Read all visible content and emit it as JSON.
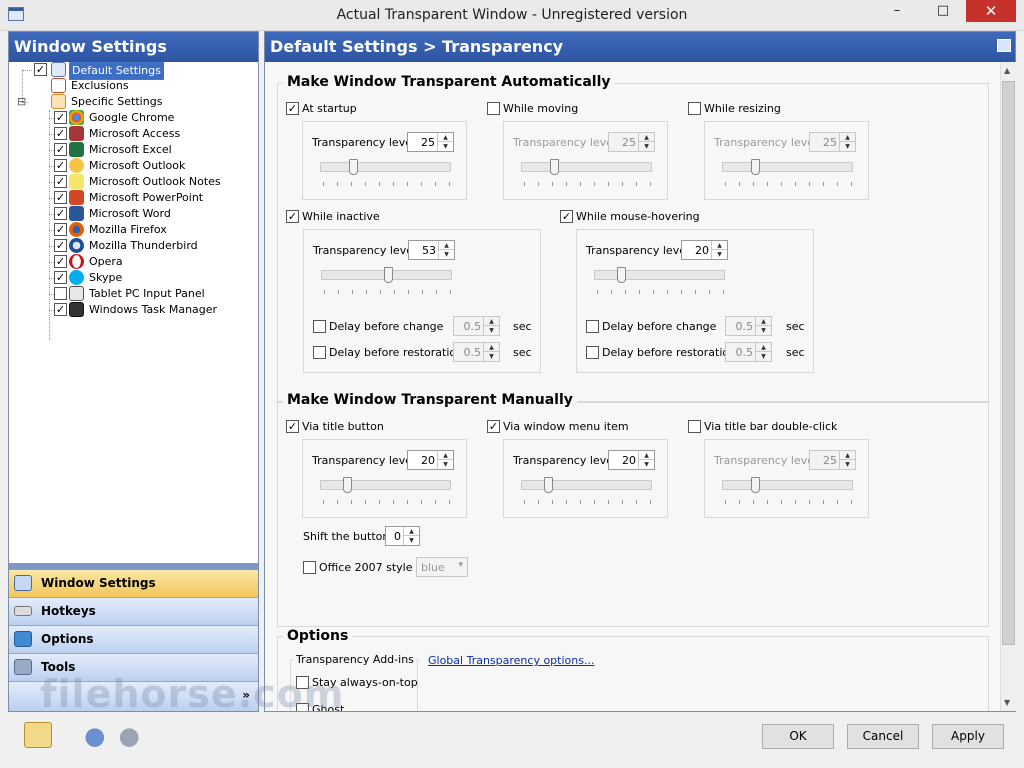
{
  "window": {
    "title": "Actual Transparent Window - Unregistered version",
    "minimize_glyph": "–",
    "maximize_glyph": "□",
    "close_glyph": "✕"
  },
  "left": {
    "header": "Window Settings",
    "tree": [
      {
        "label": "Default Settings",
        "checked": true,
        "selected": true
      },
      {
        "label": "Exclusions"
      },
      {
        "label": "Specific Settings",
        "expander": "⊟"
      },
      {
        "label": "Google Chrome",
        "checked": true
      },
      {
        "label": "Microsoft Access",
        "checked": true
      },
      {
        "label": "Microsoft Excel",
        "checked": true
      },
      {
        "label": "Microsoft Outlook",
        "checked": true
      },
      {
        "label": "Microsoft Outlook Notes",
        "checked": true
      },
      {
        "label": "Microsoft PowerPoint",
        "checked": true
      },
      {
        "label": "Microsoft Word",
        "checked": true
      },
      {
        "label": "Mozilla Firefox",
        "checked": true
      },
      {
        "label": "Mozilla Thunderbird",
        "checked": true
      },
      {
        "label": "Opera",
        "checked": true
      },
      {
        "label": "Skype",
        "checked": true
      },
      {
        "label": "Tablet PC Input Panel",
        "checked": false
      },
      {
        "label": "Windows Task Manager",
        "checked": true
      }
    ],
    "nav": {
      "window_settings": "Window Settings",
      "hotkeys": "Hotkeys",
      "options": "Options",
      "tools": "Tools",
      "more_glyph": "»"
    }
  },
  "right": {
    "header": "Default Settings > Transparency",
    "auto": {
      "title": "Make Window Transparent Automatically",
      "at_startup": {
        "label": "At startup",
        "checked": true,
        "level_label": "Transparency level",
        "level": "25"
      },
      "while_moving": {
        "label": "While moving",
        "checked": false,
        "level_label": "Transparency level",
        "level": "25"
      },
      "while_resizing": {
        "label": "While resizing",
        "checked": false,
        "level_label": "Transparency level",
        "level": "25"
      },
      "while_inactive": {
        "label": "While inactive",
        "checked": true,
        "level_label": "Transparency level",
        "level": "53",
        "delay_change": "Delay before change",
        "delay_change_value": "0.5",
        "delay_restore": "Delay before restoration",
        "delay_restore_value": "0.5",
        "unit": "sec"
      },
      "while_hovering": {
        "label": "While mouse-hovering",
        "checked": true,
        "level_label": "Transparency level",
        "level": "20",
        "delay_change": "Delay before change",
        "delay_change_value": "0.5",
        "delay_restore": "Delay before restoration",
        "delay_restore_value": "0.5",
        "unit": "sec"
      }
    },
    "manual": {
      "title": "Make Window Transparent Manually",
      "via_title_button": {
        "label": "Via title button",
        "checked": true,
        "level_label": "Transparency level",
        "level": "20"
      },
      "via_menu_item": {
        "label": "Via window menu item",
        "checked": true,
        "level_label": "Transparency level",
        "level": "20"
      },
      "via_double_click": {
        "label": "Via title bar double-click",
        "checked": false,
        "level_label": "Transparency level",
        "level": "25"
      },
      "shift_label": "Shift the buttons",
      "shift_value": "0",
      "office_style": "Office 2007 style",
      "office_style_value": "blue"
    },
    "options": {
      "title": "Options",
      "addins_title": "Transparency Add-ins",
      "global_link": "Global Transparency options...",
      "stay_on_top": "Stay always-on-top",
      "ghost": "Ghost"
    }
  },
  "buttons": {
    "ok": "OK",
    "cancel": "Cancel",
    "apply": "Apply"
  },
  "watermark": "filehorse.com",
  "colors": {
    "header_blue": "#2e55a3",
    "selection": "#3c6ec4",
    "nav_active": "#f2c65b",
    "link": "#0b2fa8",
    "close_red": "#c7312b"
  }
}
